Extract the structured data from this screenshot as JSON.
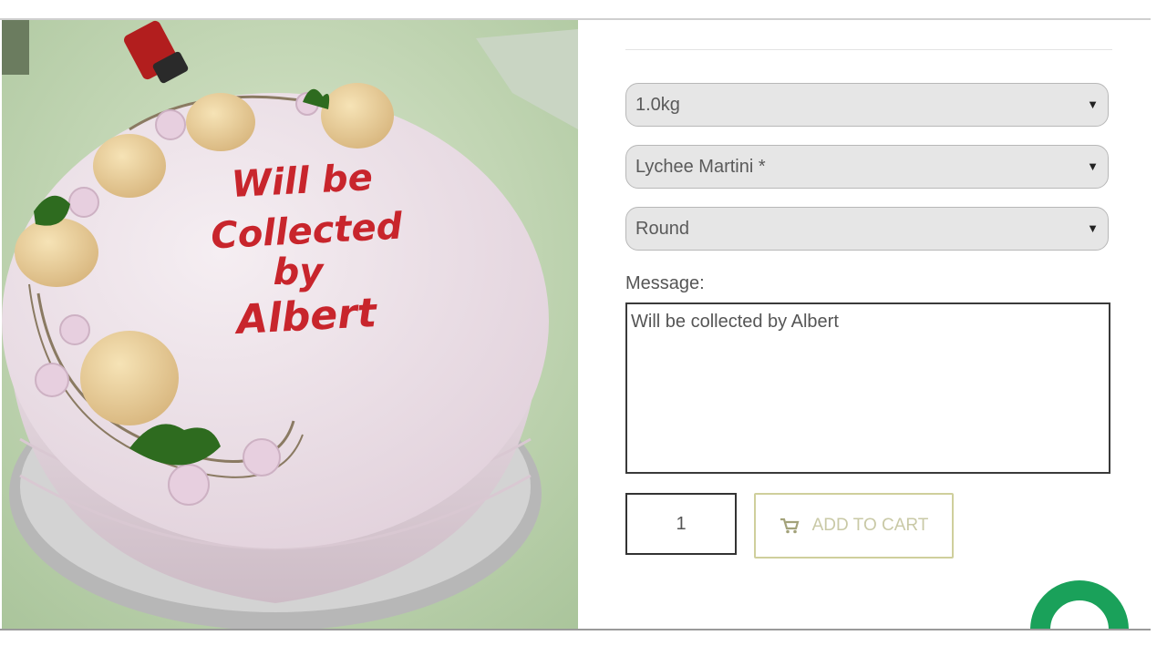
{
  "product": {
    "weight_select": {
      "value": "1.0kg"
    },
    "flavour_select": {
      "value": "Lychee Martini *"
    },
    "shape_select": {
      "value": "Round"
    },
    "message": {
      "label": "Message:",
      "value": "Will be collected by Albert"
    },
    "quantity": {
      "value": "1"
    },
    "add_to_cart": {
      "label": "ADD TO CART",
      "icon": "cart-icon"
    }
  },
  "cake_photo": {
    "inscription": [
      "Will be",
      "Collected",
      "by",
      "Albert"
    ]
  },
  "chat_widget": {
    "icon": "chat-bubble-icon",
    "color": "#1aa15a"
  },
  "colors": {
    "cart_border": "#cfcf9c",
    "cart_text": "#c9c9a6",
    "select_bg": "#e6e6e6"
  }
}
